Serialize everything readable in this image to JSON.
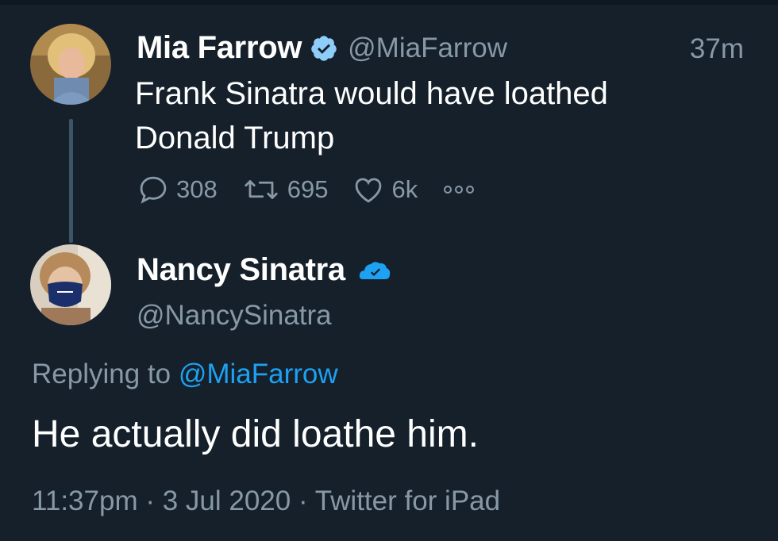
{
  "original_tweet": {
    "display_name": "Mia Farrow",
    "handle": "@MiaFarrow",
    "time_ago": "37m",
    "text_line1": "Frank Sinatra would have loathed",
    "text_line2": "Donald Trump",
    "replies": "308",
    "retweets": "695",
    "likes": "6k"
  },
  "reply_tweet": {
    "display_name": "Nancy Sinatra",
    "handle": "@NancySinatra",
    "replying_prefix": "Replying to",
    "replying_mention": "@MiaFarrow",
    "text": "He actually did loathe him.",
    "meta": "11:37pm · 3 Jul 2020 · Twitter for iPad"
  },
  "colors": {
    "background": "#15202b",
    "secondary_text": "#8899a6",
    "accent": "#1da1f2"
  },
  "icons": [
    "verified-badge-icon",
    "reply-icon",
    "retweet-icon",
    "like-icon",
    "more-icon"
  ]
}
